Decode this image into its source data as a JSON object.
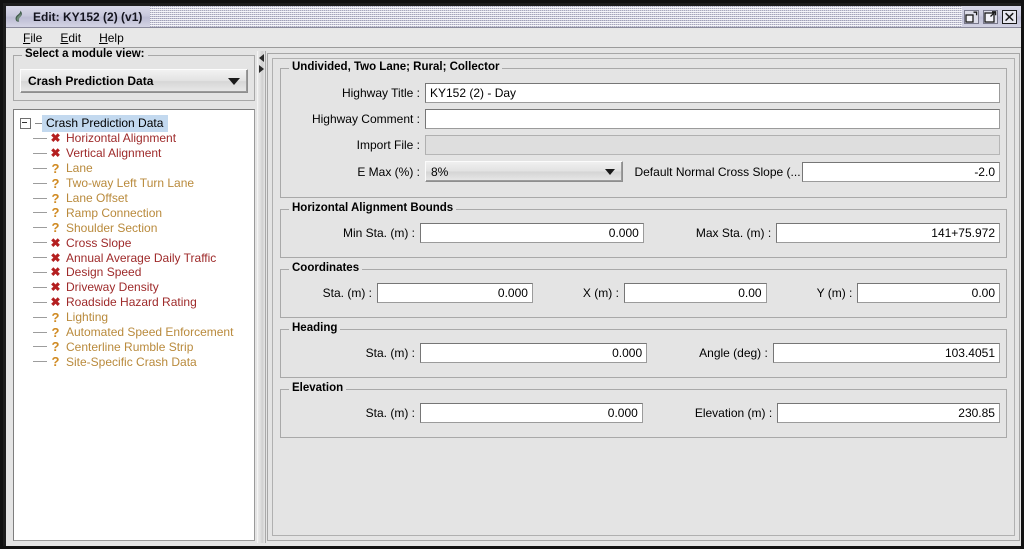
{
  "window": {
    "title": "Edit: KY152 (2) (v1)",
    "icon": "java-coffee-cup-icon",
    "buttons": [
      {
        "name": "minimize-button",
        "glyph": "restore-down"
      },
      {
        "name": "maximize-button",
        "glyph": "maximize"
      },
      {
        "name": "close-button",
        "glyph": "close-x"
      }
    ]
  },
  "menubar": {
    "items": [
      {
        "label": "File",
        "mnemonic": "F"
      },
      {
        "label": "Edit",
        "mnemonic": "E"
      },
      {
        "label": "Help",
        "mnemonic": "H"
      }
    ]
  },
  "sidebar": {
    "group_title": "Select a module view:",
    "module_combo": {
      "value": "Crash Prediction Data",
      "icon": "chevron-down-icon"
    },
    "tree": {
      "root": {
        "label": "Crash Prediction Data",
        "expanded": true,
        "selected": true
      },
      "items": [
        {
          "label": "Horizontal Alignment",
          "status": "x"
        },
        {
          "label": "Vertical Alignment",
          "status": "x"
        },
        {
          "label": "Lane",
          "status": "q"
        },
        {
          "label": "Two-way Left Turn Lane",
          "status": "q"
        },
        {
          "label": "Lane Offset",
          "status": "q"
        },
        {
          "label": "Ramp Connection",
          "status": "q"
        },
        {
          "label": "Shoulder Section",
          "status": "q"
        },
        {
          "label": "Cross Slope",
          "status": "x"
        },
        {
          "label": "Annual Average Daily Traffic",
          "status": "x"
        },
        {
          "label": "Design Speed",
          "status": "x"
        },
        {
          "label": "Driveway Density",
          "status": "x"
        },
        {
          "label": "Roadside Hazard Rating",
          "status": "x"
        },
        {
          "label": "Lighting",
          "status": "q"
        },
        {
          "label": "Automated Speed Enforcement",
          "status": "q"
        },
        {
          "label": "Centerline Rumble Strip",
          "status": "q"
        },
        {
          "label": "Site-Specific Crash Data",
          "status": "q"
        }
      ]
    }
  },
  "main": {
    "general": {
      "title": "Undivided, Two Lane; Rural; Collector",
      "highway_title_label": "Highway Title :",
      "highway_title_value": "KY152 (2) - Day",
      "highway_comment_label": "Highway Comment :",
      "highway_comment_value": "",
      "import_file_label": "Import File :",
      "import_file_value": "",
      "emax_label": "E Max (%) :",
      "emax_value": "8%",
      "cross_slope_label": "Default Normal Cross Slope (...",
      "cross_slope_value": "-2.0"
    },
    "hab": {
      "title": "Horizontal Alignment Bounds",
      "min_sta_label": "Min Sta. (m) :",
      "min_sta_value": "0.000",
      "max_sta_label": "Max Sta. (m) :",
      "max_sta_value": "141+75.972"
    },
    "coordinates": {
      "title": "Coordinates",
      "sta_label": "Sta. (m) :",
      "sta_value": "0.000",
      "x_label": "X (m) :",
      "x_value": "0.00",
      "y_label": "Y (m) :",
      "y_value": "0.00"
    },
    "heading": {
      "title": "Heading",
      "sta_label": "Sta. (m) :",
      "sta_value": "0.000",
      "angle_label": "Angle (deg) :",
      "angle_value": "103.4051"
    },
    "elevation": {
      "title": "Elevation",
      "sta_label": "Sta. (m) :",
      "sta_value": "0.000",
      "elev_label": "Elevation (m) :",
      "elev_value": "230.85"
    }
  },
  "colors": {
    "titlebar": "#c9c9dd",
    "panel_bg": "#e4e4e4",
    "error_icon": "#b41f20",
    "warn_icon": "#d08a22",
    "error_text": "#9e2a2a",
    "warn_text": "#b98a3c",
    "tree_selection": "#c3d9ef"
  }
}
